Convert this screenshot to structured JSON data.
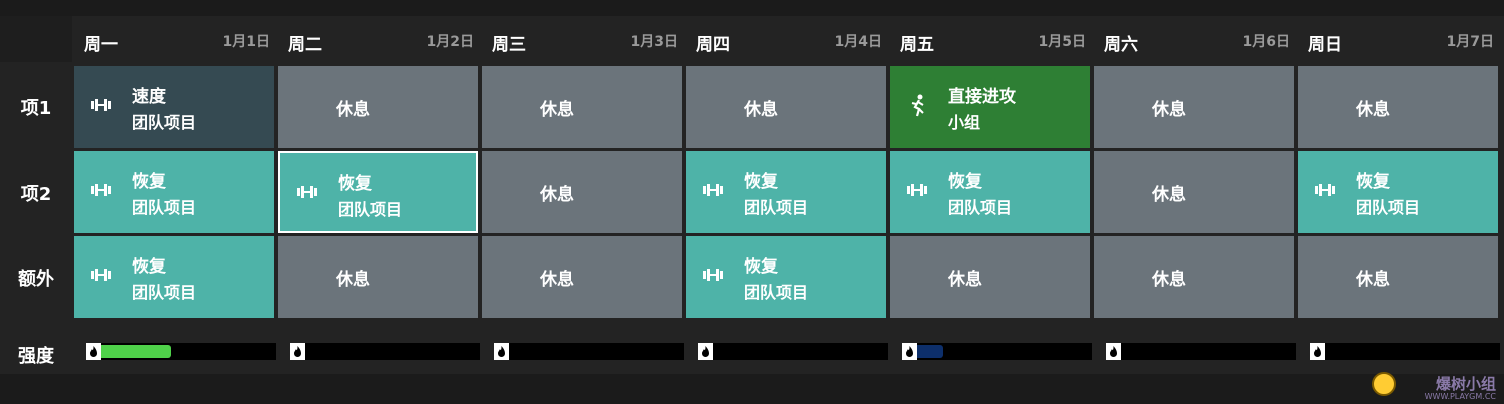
{
  "days": [
    {
      "name": "周一",
      "date": "1月1日"
    },
    {
      "name": "周二",
      "date": "1月2日"
    },
    {
      "name": "周三",
      "date": "1月3日"
    },
    {
      "name": "周四",
      "date": "1月4日"
    },
    {
      "name": "周五",
      "date": "1月5日"
    },
    {
      "name": "周六",
      "date": "1月6日"
    },
    {
      "name": "周日",
      "date": "1月7日"
    }
  ],
  "rows": [
    {
      "label": "项1"
    },
    {
      "label": "项2"
    },
    {
      "label": "额外"
    }
  ],
  "sessions": [
    [
      {
        "type": "speed",
        "title": "速度",
        "sub": "团队项目",
        "icon": "dumbbell-icon"
      },
      {
        "type": "rest",
        "title": "休息"
      },
      {
        "type": "rest",
        "title": "休息"
      },
      {
        "type": "rest",
        "title": "休息"
      },
      {
        "type": "attack",
        "title": "直接进攻",
        "sub": "小组",
        "icon": "running-person-icon"
      },
      {
        "type": "rest",
        "title": "休息"
      },
      {
        "type": "rest",
        "title": "休息"
      }
    ],
    [
      {
        "type": "recovery",
        "title": "恢复",
        "sub": "团队项目",
        "icon": "dumbbell-icon"
      },
      {
        "type": "recovery",
        "title": "恢复",
        "sub": "团队项目",
        "icon": "dumbbell-icon",
        "selected": true
      },
      {
        "type": "rest",
        "title": "休息"
      },
      {
        "type": "recovery",
        "title": "恢复",
        "sub": "团队项目",
        "icon": "dumbbell-icon"
      },
      {
        "type": "recovery",
        "title": "恢复",
        "sub": "团队项目",
        "icon": "dumbbell-icon"
      },
      {
        "type": "rest",
        "title": "休息"
      },
      {
        "type": "recovery",
        "title": "恢复",
        "sub": "团队项目",
        "icon": "dumbbell-icon"
      }
    ],
    [
      {
        "type": "recovery",
        "title": "恢复",
        "sub": "团队项目",
        "icon": "dumbbell-icon"
      },
      {
        "type": "rest",
        "title": "休息"
      },
      {
        "type": "rest",
        "title": "休息"
      },
      {
        "type": "recovery",
        "title": "恢复",
        "sub": "团队项目",
        "icon": "dumbbell-icon"
      },
      {
        "type": "rest",
        "title": "休息"
      },
      {
        "type": "rest",
        "title": "休息"
      },
      {
        "type": "rest",
        "title": "休息"
      }
    ]
  ],
  "intensity": {
    "label": "强度",
    "levels": [
      0.4,
      0,
      0,
      0,
      0.15,
      0,
      0
    ],
    "colors": [
      "#4fd24a",
      "#000000",
      "#000000",
      "#000000",
      "#0d2f6b",
      "#000000",
      "#000000"
    ]
  },
  "watermark": {
    "text": "爆树小组",
    "sub": "WWW.PLAYGM.CC"
  }
}
